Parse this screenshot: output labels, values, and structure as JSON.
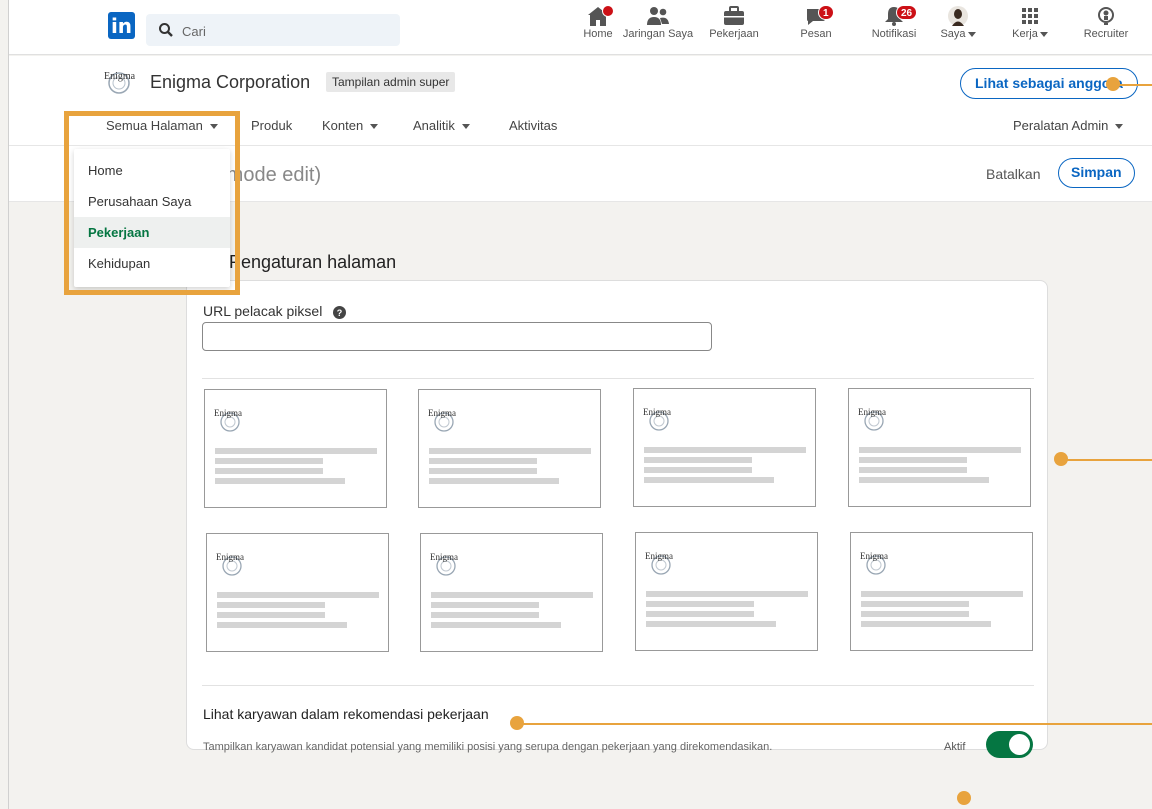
{
  "topnav": {
    "logo": "in",
    "search_placeholder": "Cari",
    "items": [
      {
        "label": "Home",
        "icon": "home-icon"
      },
      {
        "label": "Jaringan Saya",
        "icon": "network-icon"
      },
      {
        "label": "Pekerjaan",
        "icon": "briefcase-icon"
      },
      {
        "label": "Pesan",
        "icon": "message-icon",
        "badge": "1"
      },
      {
        "label": "Notifikasi",
        "icon": "bell-icon",
        "badge": "26"
      },
      {
        "label": "Saya",
        "icon": "avatar"
      },
      {
        "label": "Kerja",
        "icon": "grid-icon"
      },
      {
        "label": "Recruiter",
        "icon": "recruiter-icon"
      }
    ]
  },
  "company": {
    "logo_text": "Enigma",
    "name": "Enigma Corporation",
    "admin_tag": "Tampilan admin super",
    "view_member": "Lihat sebagai anggota"
  },
  "subnav": {
    "items": [
      "Semua Halaman",
      "Produk",
      "Konten",
      "Analitik",
      "Aktivitas"
    ],
    "admin_tools": "Peralatan Admin"
  },
  "edit_bar": {
    "title": "(mode edit)",
    "cancel": "Batalkan",
    "save": "Simpan"
  },
  "dropdown": {
    "items": [
      "Home",
      "Perusahaan Saya",
      "Pekerjaan",
      "Kehidupan"
    ],
    "active": "Pekerjaan"
  },
  "settings": {
    "title": "Pengaturan halaman",
    "pixel_label": "URL pelacak piksel",
    "pixel_value": "",
    "template_logo_text": "Enigma",
    "employee_title": "Lihat karyawan dalam rekomendasi pekerjaan",
    "employee_desc": "Tampilkan karyawan kandidat potensial yang memiliki posisi yang serupa dengan pekerjaan yang direkomendasikan.",
    "toggle_label": "Aktif",
    "toggle_on": true
  },
  "colors": {
    "brand": "#0a66c2",
    "accent_green": "#057642",
    "callout": "#e8a33d",
    "badge": "#cc1016"
  }
}
